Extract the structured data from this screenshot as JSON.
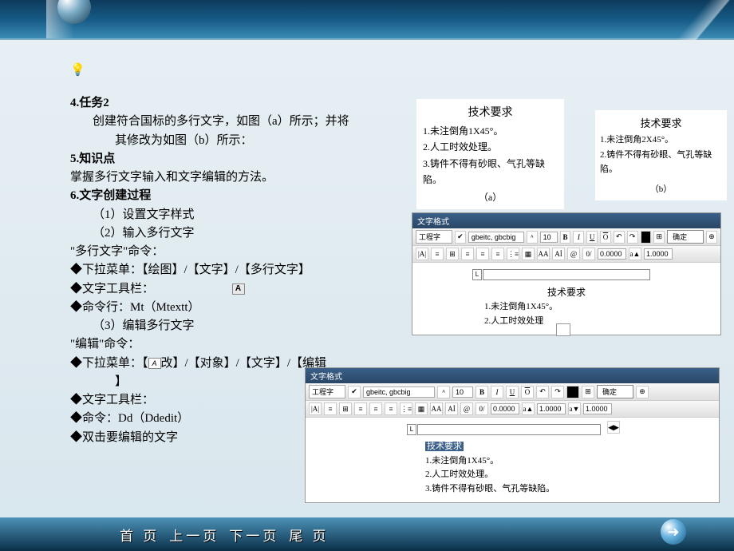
{
  "content": {
    "h4": "4.任务2",
    "t4a": "创建符合国标的多行文字，如图（a）所示；并将",
    "t4b": "其修改为如图（b）所示：",
    "h5": "5.知识点",
    "t5": "掌握多行文字输入和文字编辑的方法。",
    "h6": "6.文字创建过程",
    "s1": "（1）设置文字样式",
    "s2": "（2）输入多行文字",
    "mline_cmd": "\"多行文字\"命令：",
    "m_menu": "◆下拉菜单：【绘图】/【文字】/【多行文字】",
    "m_toolbar": "◆文字工具栏：",
    "m_cmdline": "◆命令行：Mt（Mtextt）",
    "s3": "（3）编辑多行文字",
    "edit_cmd": "\"编辑\"命令：",
    "e_menu_1": "◆下拉菜单：【",
    "e_menu_2": "改】/【对象】/【文字】/【编辑",
    "e_menu_3": "】",
    "e_toolbar": "◆文字工具栏：",
    "e_cmdline": "◆命令：Dd（Ddedit）",
    "e_dbl": "◆双击要编辑的文字",
    "icon_a": "A",
    "icon_i": "A"
  },
  "figA": {
    "title": "技术要求",
    "l1": "1.未注倒角1X45°。",
    "l2": "2.人工时效处理。",
    "l3": "3.铸件不得有砂眼、气孔等缺陷。",
    "cap": "（a）"
  },
  "figB": {
    "title": "技术要求",
    "l1": "1.未注倒角2X45°。",
    "l2": "2.铸件不得有砂眼、气孔等缺陷。",
    "cap": "（b）"
  },
  "toolbar": {
    "title": "文字格式",
    "style": "工程字",
    "font": "gbeitc, gbcbig",
    "size": "10",
    "b": "B",
    "i": "I",
    "u": "U",
    "o": "O",
    "ok": "确定",
    "ruler_L": "L",
    "circ": "⊕",
    "spin": "◀▶",
    "at": "@",
    "slash": "0/",
    "num1": "0.0000",
    "aup": "a▲",
    "alow": "a▼",
    "num2": "1.0000",
    "num3": "1.0000",
    "iconA": "|A|",
    "iconList": "≡",
    "iconRow": "⊞",
    "AA": "AA",
    "Ai": "Aİ"
  },
  "panel1_edit": {
    "title": "技术要求",
    "l1": "1.未注倒角1X45°。",
    "l2": "2.人工时效处理"
  },
  "panel2_edit": {
    "title": "技术要求",
    "l1": "1.未注倒角1X45°。",
    "l2": "2.人工时效处理。",
    "l3": "3.铸件不得有砂眼、气孔等缺陷。"
  },
  "nav": {
    "first": "首 页",
    "prev": "上一页",
    "next": "下一页",
    "last": "尾 页",
    "arrow": "➜"
  }
}
